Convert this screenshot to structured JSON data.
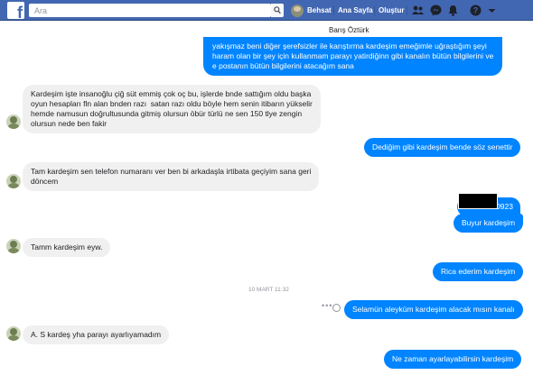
{
  "topbar": {
    "search_placeholder": "Ara",
    "user_name": "Behsat",
    "home": "Ana Sayfa",
    "create": "Oluştur",
    "colors": {
      "bar": "#4267b2",
      "outgoing": "#0084ff",
      "incoming": "#f1f0f0"
    },
    "icons": [
      "facebook-logo-icon",
      "search-icon",
      "friends-icon",
      "messenger-icon",
      "notifications-icon",
      "help-icon",
      "dropdown-icon"
    ]
  },
  "conversation": {
    "name": "Barış Öztürk",
    "timestamp": "10 MART 11:32",
    "messages": [
      {
        "dir": "out",
        "text": "yakışmaz beni diğer şerefsizler ile karıştırma kardeşim emeğimle uğraştığım şeyi\nharam olan bir şey için kullanmam parayı yatirdiğinn gibi kanalın bütün bilgilerini ve\ne postanın bütün bilgilerini atacağım sana"
      },
      {
        "dir": "in",
        "text": "Kardeşim işte insanoğlu çiğ süt emmiş çok oç bu, işlerde bnde sattığım oldu başka\noyun hesapları fln alan bnden razı  satan razı oldu böyle hem senin itibarın yükselir\nhemde namusun doğrultusunda gitmiş olursun öbür türlü ne sen 150 tlye zengin\nolursun nede ben fakir"
      },
      {
        "dir": "out",
        "text": "Dediğim gibi kardeşim bende söz senettir"
      },
      {
        "dir": "in",
        "text": "Tam kardeşim sen telefon numaranı ver ben bi arkadaşla irtibata geçiyim sana geri\ndöncem"
      },
      {
        "dir": "out",
        "text": "0923"
      },
      {
        "dir": "out",
        "text": "Buyur kardeşim"
      },
      {
        "dir": "in",
        "text": "Tamm kardeşim eyw."
      },
      {
        "dir": "out",
        "text": "Rica ederim kardeşim"
      },
      {
        "dir": "out",
        "text": "Selamün aleyküm kardeşim alacak mısın kanalı"
      },
      {
        "dir": "in",
        "text": "A. S kardeş yha parayı ayarlıyamadım"
      },
      {
        "dir": "out",
        "text": "Ne zaman ayarlayabilirsin kardeşim"
      }
    ]
  }
}
